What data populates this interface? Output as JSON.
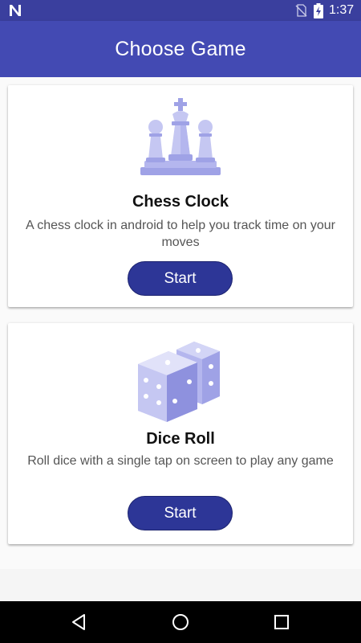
{
  "status_bar": {
    "time": "1:37",
    "icons": [
      "n-notification-icon",
      "no-sim-icon",
      "battery-charging-icon"
    ]
  },
  "app_bar": {
    "title": "Choose Game"
  },
  "games": [
    {
      "title": "Chess Clock",
      "description": "A chess clock in android to help you track time on your moves",
      "button_label": "Start",
      "icon": "chess-pieces-icon"
    },
    {
      "title": "Dice Roll",
      "description": "Roll dice with a single tap on screen to play any game",
      "button_label": "Start",
      "icon": "dice-icon"
    }
  ],
  "nav_bar": {
    "icons": [
      "back-icon",
      "home-icon",
      "recents-icon"
    ]
  },
  "colors": {
    "status_bar": "#3a3f9e",
    "app_bar": "#434ab3",
    "button": "#2d3697",
    "illustration_light": "#c5c7f2",
    "illustration_mid": "#9fa2e6",
    "illustration_dark": "#7d80d6"
  }
}
